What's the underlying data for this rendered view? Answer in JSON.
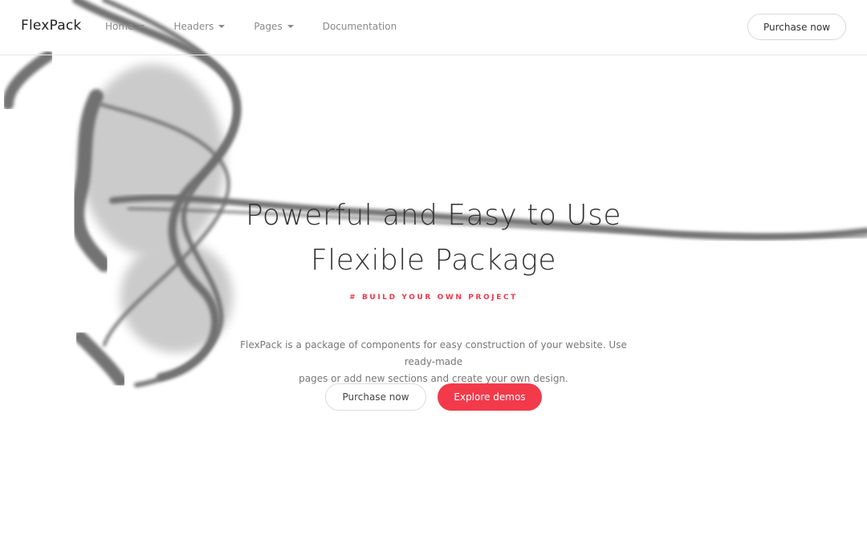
{
  "navbar": {
    "brand": "FlexPack",
    "items": [
      {
        "label": "Home",
        "dropdown": true
      },
      {
        "label": "Headers",
        "dropdown": true
      },
      {
        "label": "Pages",
        "dropdown": true
      },
      {
        "label": "Documentation",
        "dropdown": false
      }
    ],
    "cta": "Purchase now"
  },
  "hero": {
    "title_line1": "Powerful and Easy to Use",
    "title_line2": "Flexible Package",
    "tagline": "# BUILD YOUR OWN PROJECT",
    "description_line1": "FlexPack is a package of components for easy construction of your website. Use ready-made",
    "description_line2": "pages or add new sections and create your own design.",
    "buttons": {
      "secondary": "Purchase now",
      "primary": "Explore demos"
    }
  },
  "colors": {
    "accent": "#f23a4b",
    "smoke": "#555555"
  }
}
